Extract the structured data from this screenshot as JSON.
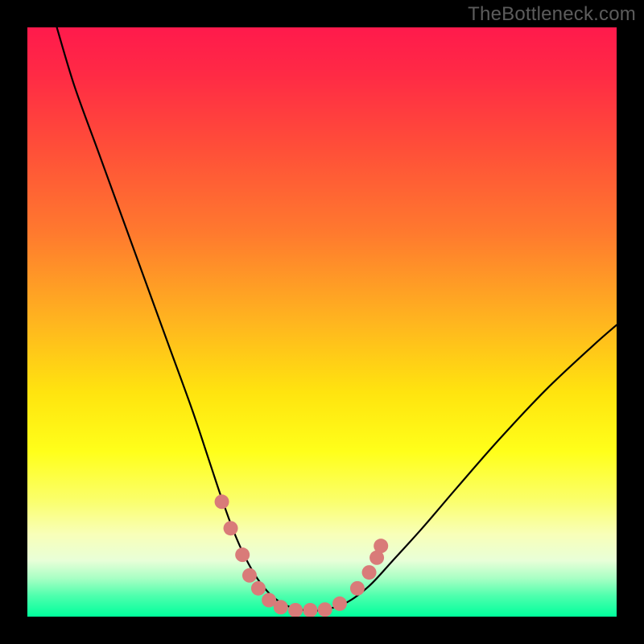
{
  "watermark": {
    "text": "TheBottleneck.com"
  },
  "colors": {
    "frame": "#000000",
    "gradient_stops": [
      {
        "offset": 0.0,
        "color": "#ff1a4c"
      },
      {
        "offset": 0.08,
        "color": "#ff2a45"
      },
      {
        "offset": 0.2,
        "color": "#ff4d39"
      },
      {
        "offset": 0.35,
        "color": "#ff7a2e"
      },
      {
        "offset": 0.5,
        "color": "#ffb51f"
      },
      {
        "offset": 0.62,
        "color": "#ffe40f"
      },
      {
        "offset": 0.72,
        "color": "#ffff1a"
      },
      {
        "offset": 0.8,
        "color": "#fbff68"
      },
      {
        "offset": 0.86,
        "color": "#f8ffb8"
      },
      {
        "offset": 0.905,
        "color": "#e8ffd8"
      },
      {
        "offset": 0.935,
        "color": "#a8ffc4"
      },
      {
        "offset": 0.965,
        "color": "#4dffad"
      },
      {
        "offset": 1.0,
        "color": "#00ff9c"
      }
    ],
    "curve": "#000000",
    "markers": "#d97b79"
  },
  "chart_data": {
    "type": "line",
    "title": "",
    "xlabel": "",
    "ylabel": "",
    "xlim": [
      0,
      100
    ],
    "ylim": [
      0,
      100
    ],
    "grid": false,
    "series": [
      {
        "name": "bottleneck-curve",
        "x": [
          5,
          8,
          12,
          16,
          20,
          24,
          28,
          31,
          33,
          35,
          37,
          39,
          41,
          43,
          45,
          47,
          50,
          54,
          58,
          62,
          67,
          73,
          80,
          88,
          96,
          100
        ],
        "y": [
          100,
          90,
          79,
          68,
          57,
          46,
          35,
          26,
          20,
          14.5,
          10,
          6.5,
          4,
          2.4,
          1.5,
          1.1,
          1.1,
          2.3,
          5.2,
          9.5,
          15,
          22,
          30,
          38.5,
          46,
          49.5
        ]
      }
    ],
    "markers": [
      {
        "x": 33.0,
        "y": 19.5
      },
      {
        "x": 34.5,
        "y": 15.0
      },
      {
        "x": 36.5,
        "y": 10.5
      },
      {
        "x": 37.7,
        "y": 7.0
      },
      {
        "x": 39.2,
        "y": 4.8
      },
      {
        "x": 41.0,
        "y": 2.8
      },
      {
        "x": 43.0,
        "y": 1.6
      },
      {
        "x": 45.5,
        "y": 1.1
      },
      {
        "x": 48.0,
        "y": 1.1
      },
      {
        "x": 50.5,
        "y": 1.2
      },
      {
        "x": 53.0,
        "y": 2.2
      },
      {
        "x": 56.0,
        "y": 4.8
      },
      {
        "x": 58.0,
        "y": 7.5
      },
      {
        "x": 59.3,
        "y": 10.0
      },
      {
        "x": 60.0,
        "y": 12.0
      }
    ]
  }
}
